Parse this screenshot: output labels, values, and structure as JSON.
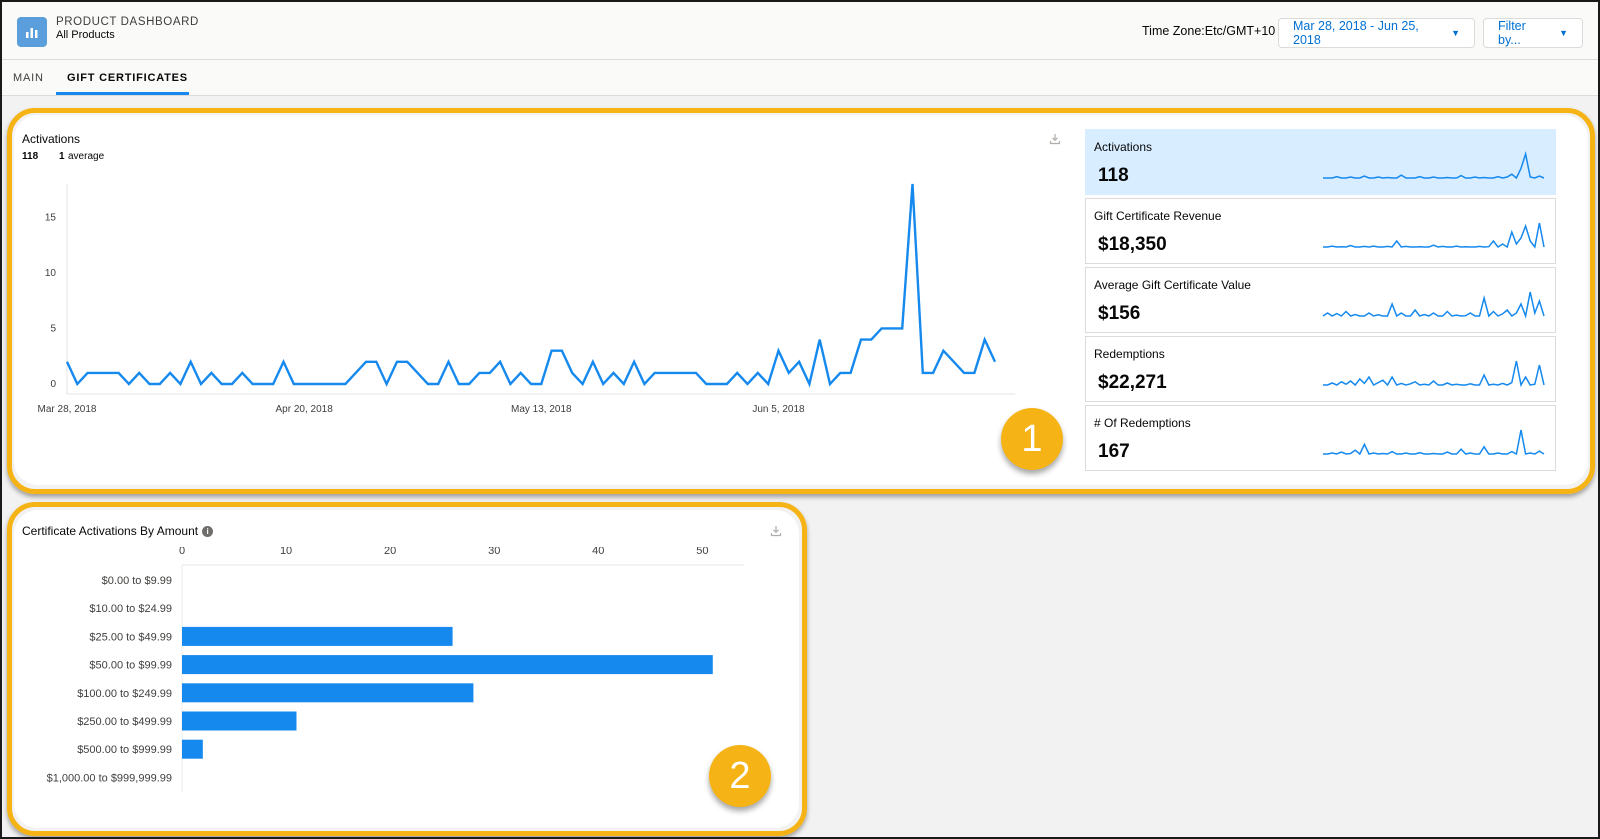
{
  "header": {
    "title": "PRODUCT DASHBOARD",
    "subtitle": "All Products",
    "timezone": "Time Zone:Etc/GMT+10",
    "date_range": "Mar 28, 2018 - Jun 25, 2018",
    "filter": "Filter by..."
  },
  "tabs": [
    {
      "label": "MAIN",
      "active": false
    },
    {
      "label": "GIFT CERTIFICATES",
      "active": true
    }
  ],
  "activations": {
    "title": "Activations",
    "total": "118",
    "average_value": "1",
    "average_label": "average"
  },
  "cards": [
    {
      "label": "Activations",
      "value": "118",
      "selected": true
    },
    {
      "label": "Gift Certificate Revenue",
      "value": "$18,350",
      "selected": false
    },
    {
      "label": "Average Gift Certificate Value",
      "value": "$156",
      "selected": false
    },
    {
      "label": "Redemptions",
      "value": "$22,271",
      "selected": false
    },
    {
      "label": "# Of Redemptions",
      "value": "167",
      "selected": false
    }
  ],
  "badges": [
    "1",
    "2"
  ],
  "bar_title": "Certificate Activations By Amount",
  "chart_data": [
    {
      "type": "line",
      "title": "Activations",
      "x_tick_labels": [
        "Mar 28, 2018",
        "Apr 20, 2018",
        "May 13, 2018",
        "Jun 5, 2018"
      ],
      "y_ticks": [
        0,
        5,
        10,
        15
      ],
      "ylim": [
        0,
        18
      ],
      "grid": false,
      "series": [
        {
          "color": "#1589ee",
          "values": [
            2,
            0,
            1,
            1,
            1,
            1,
            0,
            1,
            0,
            0,
            1,
            0,
            2,
            0,
            1,
            0,
            0,
            1,
            0,
            0,
            0,
            2,
            0,
            0,
            0,
            0,
            0,
            0,
            1,
            2,
            2,
            0,
            2,
            2,
            1,
            0,
            0,
            2,
            0,
            0,
            1,
            1,
            2,
            0,
            1,
            0,
            0,
            3,
            3,
            1,
            0,
            2,
            0,
            1,
            0,
            2,
            0,
            1,
            1,
            1,
            1,
            1,
            0,
            0,
            0,
            1,
            0,
            1,
            0,
            3,
            1,
            2,
            0,
            4,
            0,
            1,
            1,
            4,
            4,
            5,
            5,
            5,
            18,
            1,
            1,
            3,
            2,
            1,
            1,
            4,
            2
          ]
        }
      ]
    },
    {
      "type": "bar",
      "orientation": "horizontal",
      "title": "Certificate Activations By Amount",
      "categories": [
        "$0.00 to $9.99",
        "$10.00 to $24.99",
        "$25.00 to $49.99",
        "$50.00 to $99.99",
        "$100.00 to $249.99",
        "$250.00 to $499.99",
        "$500.00 to $999.99",
        "$1,000.00 to $999,999.99"
      ],
      "values": [
        0,
        0,
        26,
        51,
        28,
        11,
        2,
        0
      ],
      "x_ticks": [
        0,
        10,
        20,
        30,
        40,
        50
      ],
      "xlim": [
        0,
        54
      ],
      "color": "#1589ee"
    }
  ],
  "sparklines": [
    [
      1,
      1,
      1,
      1.3,
      1,
      1,
      1.2,
      1,
      1,
      1.4,
      1,
      1,
      1.2,
      1,
      1.1,
      1,
      1,
      1.6,
      1,
      1,
      1,
      1.3,
      1,
      1,
      1.2,
      1,
      1,
      1.1,
      1,
      1,
      1.5,
      1,
      1,
      1.2,
      1,
      1.1,
      1,
      1,
      1.3,
      1,
      1.2,
      1.8,
      1,
      3,
      6,
      1.2,
      1,
      1.4,
      1
    ],
    [
      1,
      1,
      1.3,
      1,
      1.1,
      1,
      1.5,
      1,
      1,
      1.2,
      1,
      1.3,
      1,
      1,
      1.2,
      1,
      3,
      1,
      1.2,
      1,
      1,
      1.1,
      1,
      1,
      1.6,
      1,
      1.2,
      1,
      1,
      1.3,
      1,
      1.1,
      1,
      1,
      1.2,
      1,
      1.1,
      3,
      1,
      2,
      1,
      6,
      2,
      4,
      8,
      3,
      1,
      9,
      1
    ],
    [
      1,
      2,
      1,
      1.8,
      1,
      2.5,
      1,
      1.5,
      1,
      1,
      2,
      1,
      1.4,
      1,
      1,
      5,
      1,
      2,
      1,
      1,
      3,
      1,
      1.5,
      1,
      2,
      1,
      1,
      2.5,
      1,
      1.3,
      1,
      1.1,
      2,
      1,
      1,
      7,
      1,
      2.5,
      1,
      1.7,
      3,
      1,
      2,
      5,
      1,
      9,
      2,
      6,
      1
    ],
    [
      1,
      1,
      1.5,
      1,
      1.8,
      1.2,
      2,
      1,
      2.5,
      1.4,
      3,
      1,
      1.6,
      2.2,
      1,
      3,
      1,
      1.4,
      1,
      1.3,
      1.8,
      1,
      1.2,
      1,
      2,
      1,
      1,
      1.5,
      1,
      1.2,
      1,
      1,
      1.3,
      1,
      1,
      3.5,
      1,
      1.2,
      1,
      1.4,
      1,
      1.6,
      7,
      1,
      3,
      1,
      1.2,
      6,
      1
    ],
    [
      1,
      1,
      1.2,
      1,
      1.4,
      1,
      1.1,
      1.8,
      1,
      3,
      1,
      1.2,
      1,
      1.1,
      1,
      1.5,
      1,
      1,
      1.2,
      1,
      1,
      1.3,
      1,
      1,
      1.1,
      1,
      1,
      1.4,
      1,
      1,
      2,
      1,
      1.2,
      1,
      1,
      2.5,
      1,
      1,
      1.2,
      1,
      1,
      1.5,
      1,
      6,
      1,
      1.2,
      1,
      1.6,
      1
    ]
  ]
}
